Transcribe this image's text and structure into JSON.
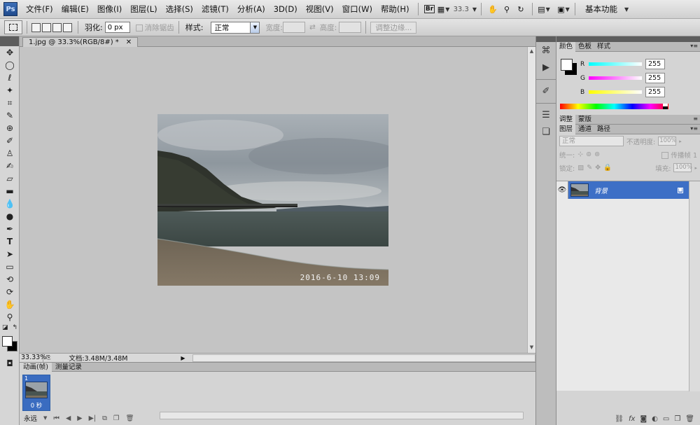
{
  "app": {
    "logo": "Ps"
  },
  "menu": [
    "文件(F)",
    "编辑(E)",
    "图像(I)",
    "图层(L)",
    "选择(S)",
    "滤镜(T)",
    "分析(A)",
    "3D(D)",
    "视图(V)",
    "窗口(W)",
    "帮助(H)"
  ],
  "appbar": {
    "bridge_label": "Br",
    "zoom": "33.3",
    "workspace": "基本功能"
  },
  "options": {
    "feather_label": "羽化:",
    "feather_value": "0 px",
    "antialias_label": "消除锯齿",
    "style_label": "样式:",
    "style_value": "正常",
    "width_label": "宽度:",
    "height_label": "高度:",
    "refine_edge": "调整边缘..."
  },
  "document": {
    "tab_title": "1.jpg @ 33.3%(RGB/8#) *",
    "zoom": "33.33%",
    "doc_info": "文档:3.48M/3.48M",
    "photo_timestamp": "2016-6-10 13:09"
  },
  "animation_panel": {
    "tabs": [
      "动画(帧)",
      "测量记录"
    ],
    "frame_number": "1",
    "frame_delay": "0 秒",
    "loop_value": "永远"
  },
  "color_panel": {
    "tabs": [
      "颜色",
      "色板",
      "样式"
    ],
    "channels": [
      {
        "label": "R",
        "value": "255"
      },
      {
        "label": "G",
        "value": "255"
      },
      {
        "label": "B",
        "value": "255"
      }
    ]
  },
  "adjust_panel": {
    "tabs": [
      "调整",
      "蒙版"
    ]
  },
  "layers_panel": {
    "tabs": [
      "图层",
      "通道",
      "路径"
    ],
    "blend_mode": "正常",
    "opacity_label": "不透明度:",
    "opacity_value": "100%",
    "unify_label": "统一:",
    "propagate_label": "传播帧 1",
    "lock_label": "锁定:",
    "fill_label": "填充:",
    "fill_value": "100%",
    "layer_name": "背景"
  },
  "colors": {
    "accent_selection": "#3d6fc6",
    "canvas_bg": "#c4c4c4",
    "panel_bg": "#d4d4d4"
  }
}
